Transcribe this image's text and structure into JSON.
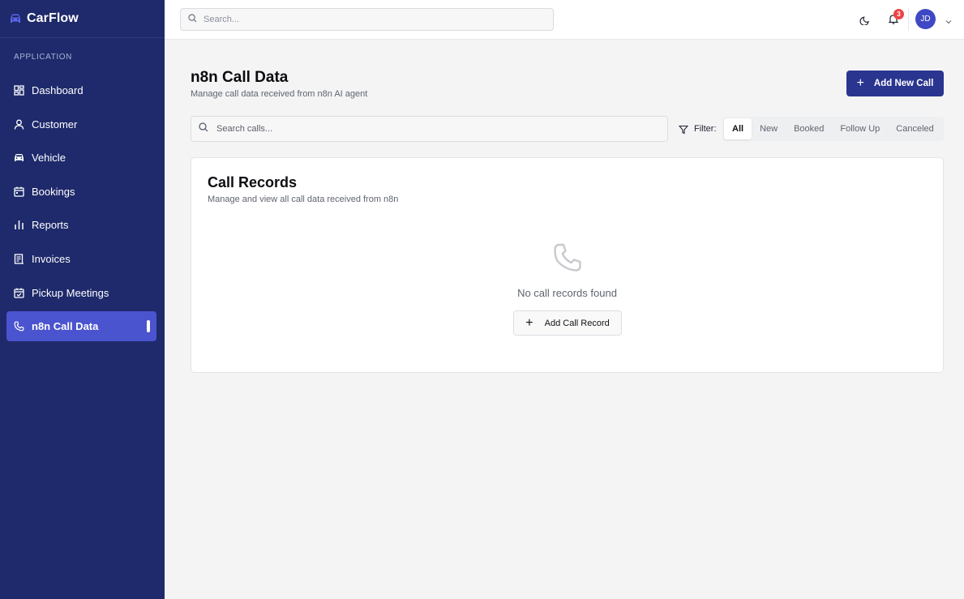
{
  "app": {
    "name": "CarFlow"
  },
  "sidebar": {
    "section_label": "APPLICATION",
    "items": [
      {
        "label": "Dashboard",
        "icon": "dashboard-icon"
      },
      {
        "label": "Customer",
        "icon": "user-icon"
      },
      {
        "label": "Vehicle",
        "icon": "car-icon"
      },
      {
        "label": "Bookings",
        "icon": "calendar-icon"
      },
      {
        "label": "Reports",
        "icon": "bar-chart-icon"
      },
      {
        "label": "Invoices",
        "icon": "invoice-icon"
      },
      {
        "label": "Pickup Meetings",
        "icon": "calendar-check-icon"
      },
      {
        "label": "n8n Call Data",
        "icon": "phone-icon",
        "active": true
      }
    ]
  },
  "topbar": {
    "search_placeholder": "Search...",
    "notification_count": "3",
    "avatar_initials": "JD"
  },
  "page": {
    "title": "n8n Call Data",
    "subtitle": "Manage call data received from n8n AI agent",
    "add_button": "Add New Call",
    "search_placeholder": "Search calls...",
    "filter_label": "Filter:",
    "filters": [
      "All",
      "New",
      "Booked",
      "Follow Up",
      "Canceled"
    ],
    "active_filter": "All"
  },
  "card": {
    "title": "Call Records",
    "subtitle": "Manage and view all call data received from n8n",
    "empty_text": "No call records found",
    "add_button": "Add Call Record"
  },
  "colors": {
    "sidebar_bg": "#1e2a6b",
    "active_item": "#4b54cf",
    "primary_button": "#2a3590",
    "badge": "#ef4444"
  }
}
